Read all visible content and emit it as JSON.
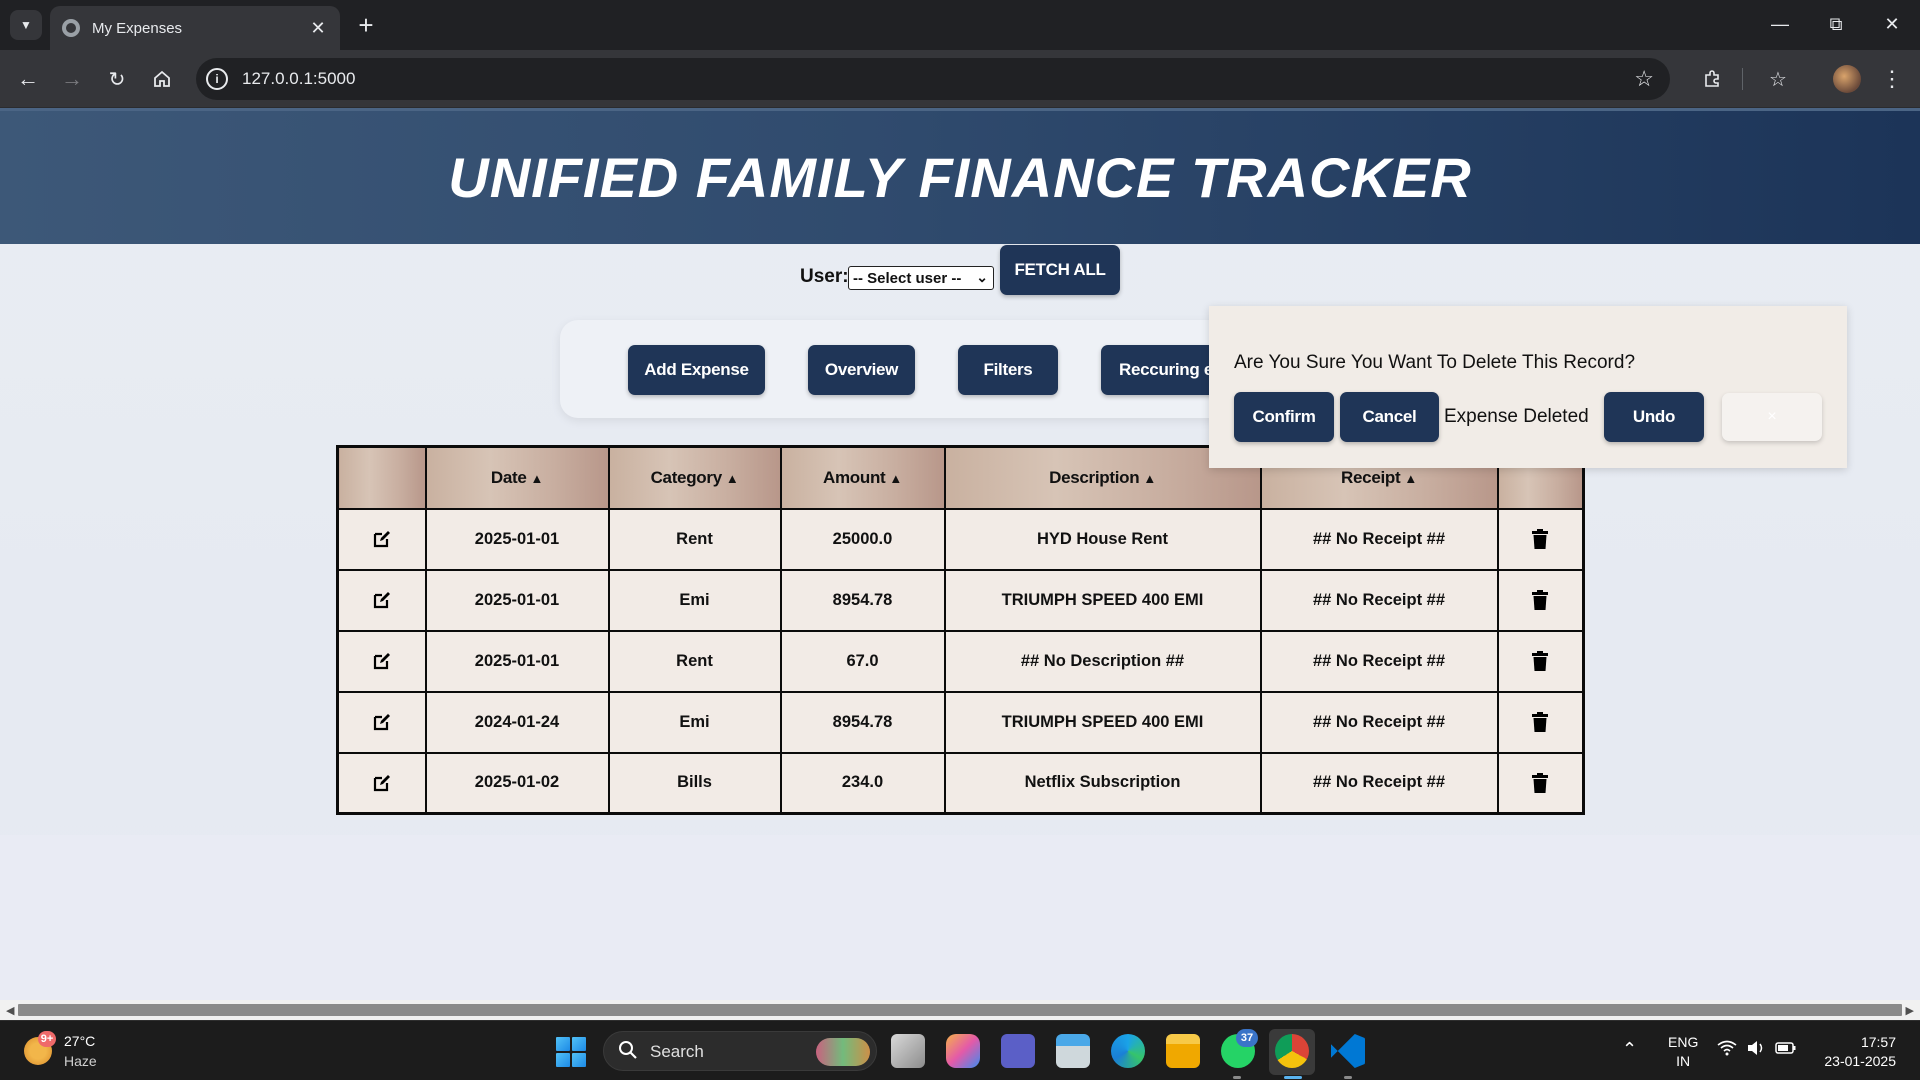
{
  "browser": {
    "tab_title": "My Expenses",
    "url": "127.0.0.1:5000"
  },
  "page": {
    "title": "UNIFIED FAMILY FINANCE TRACKER",
    "user_label": "User:",
    "user_select_value": "-- Select user --",
    "fetch_all_label": "FETCH ALL",
    "actions": [
      {
        "label": "Add Expense"
      },
      {
        "label": "Overview"
      },
      {
        "label": "Filters"
      },
      {
        "label": "Reccuring e"
      }
    ]
  },
  "table": {
    "headers": [
      "",
      "Date",
      "Category",
      "Amount",
      "Description",
      "Receipt",
      ""
    ],
    "rows": [
      {
        "date": "2025-01-01",
        "category": "Rent",
        "amount": "25000.0",
        "description": "HYD House Rent",
        "receipt": "## No Receipt ##"
      },
      {
        "date": "2025-01-01",
        "category": "Emi",
        "amount": "8954.78",
        "description": "TRIUMPH SPEED 400 EMI",
        "receipt": "## No Receipt ##"
      },
      {
        "date": "2025-01-01",
        "category": "Rent",
        "amount": "67.0",
        "description": "## No Description ##",
        "receipt": "## No Receipt ##"
      },
      {
        "date": "2024-01-24",
        "category": "Emi",
        "amount": "8954.78",
        "description": "TRIUMPH SPEED 400 EMI",
        "receipt": "## No Receipt ##"
      },
      {
        "date": "2025-01-02",
        "category": "Bills",
        "amount": "234.0",
        "description": "Netflix Subscription",
        "receipt": "## No Receipt ##"
      }
    ]
  },
  "modal": {
    "question": "Are You Sure You Want To Delete This Record?",
    "confirm_label": "Confirm",
    "cancel_label": "Cancel",
    "status_text": "Expense Deleted",
    "undo_label": "Undo",
    "close_label": "×"
  },
  "taskbar": {
    "weather_badge": "9+",
    "temperature": "27°C",
    "weather_desc": "Haze",
    "search_label": "Search",
    "whatsapp_badge": "37",
    "lang_line1": "ENG",
    "lang_line2": "IN",
    "time": "17:57",
    "date": "23-01-2025"
  },
  "colors": {
    "header_navy": "#1c3458",
    "button_navy": "#1f3557",
    "table_header": "#c9b1a0",
    "table_cell": "#f2ebe6",
    "modal_bg": "#f1ece7"
  }
}
